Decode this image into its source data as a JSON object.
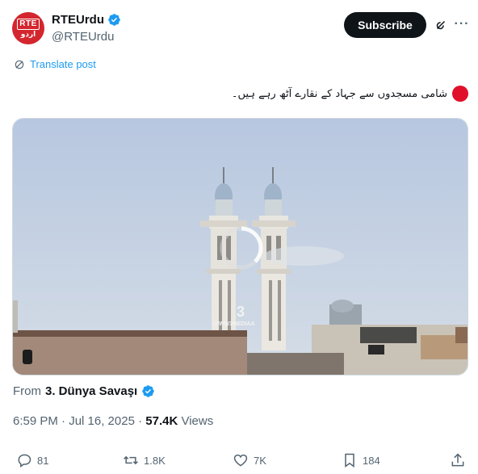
{
  "account": {
    "avatar_text_top": "RTE",
    "avatar_text_bottom": "اردو",
    "display_name": "RTEUrdu",
    "handle": "@RTEUrdu"
  },
  "header": {
    "subscribe_label": "Subscribe"
  },
  "post": {
    "translate_label": "Translate post",
    "text": "شامی مسجدوں سے جہاد کے نقارے آٹھ رہے ہیں۔",
    "video_watermark": "3",
    "video_watermark_sub": "@WW3MEDIAA",
    "from_label": "From",
    "from_source": "3. Dünya Savaşı",
    "time": "6:59 PM · Jul 16, 2025 · ",
    "views_count": "57.4K",
    "views_label": " Views"
  },
  "actions": {
    "replies": "81",
    "reposts": "1.8K",
    "likes": "7K",
    "bookmarks": "184"
  },
  "colors": {
    "accent": "#1d9bf0",
    "brand_red": "#d3262e",
    "text_secondary": "#536471"
  }
}
